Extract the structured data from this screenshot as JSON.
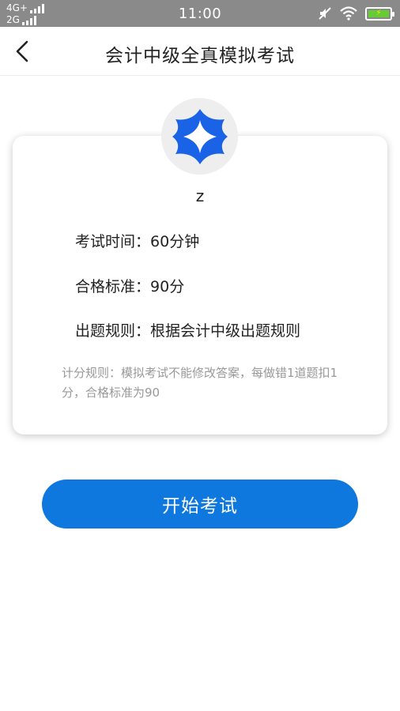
{
  "status_bar": {
    "network_top": "4G+",
    "network_bottom": "2G",
    "time": "11:00"
  },
  "header": {
    "title": "会计中级全真模拟考试",
    "back_icon": "chevron-left-icon"
  },
  "profile": {
    "avatar_icon": "four-point-star-logo",
    "username": "z"
  },
  "exam_info": {
    "duration_label": "考试时间：",
    "duration_value": "60分钟",
    "pass_label": "合格标准：",
    "pass_value": "90分",
    "rule_label": "出题规则：",
    "rule_value": "根据会计中级出题规则",
    "scoring_note": "计分规则：模拟考试不能修改答案，每做错1道题扣1分，合格标准为90"
  },
  "actions": {
    "start_label": "开始考试"
  },
  "colors": {
    "status_bar_bg": "#8a8a8a",
    "primary": "#0e78de",
    "avatar_bg": "#eeeeee",
    "note_text": "#999999"
  }
}
